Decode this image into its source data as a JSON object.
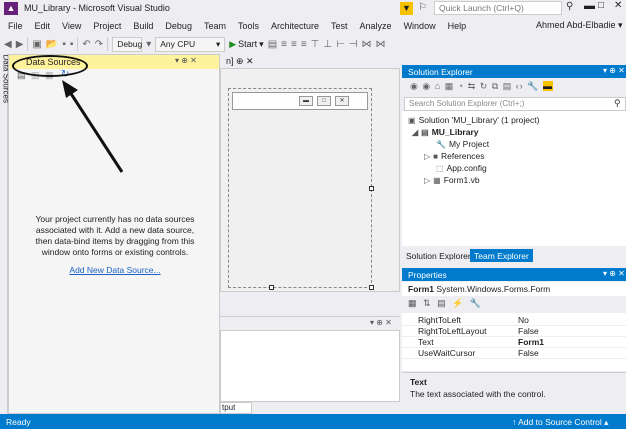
{
  "window": {
    "logo": "▲",
    "title": "MU_Library - Microsoft Visual Studio",
    "quick_launch_placeholder": "Quick Launch (Ctrl+Q)",
    "minimize": "▬",
    "maximize": "□",
    "close": "✕"
  },
  "menu": {
    "items": [
      "File",
      "Edit",
      "View",
      "Project",
      "Build",
      "Debug",
      "Team",
      "Tools",
      "Architecture",
      "Test",
      "Analyze",
      "Window",
      "Help"
    ],
    "user": "Ahmed Abd-Elbadie ▾"
  },
  "toolbar": {
    "config": "Debug",
    "platform": "Any CPU",
    "start": "Start"
  },
  "data_sources": {
    "side_tab_label": "Data Sources",
    "title": "Data Sources",
    "header_controls": "▾ ⊕ ✕",
    "message": "Your project currently has no data sources associated with it. Add a new data source, then data-bind items by dragging from this window onto forms or existing controls.",
    "add_link": "Add New Data Source..."
  },
  "designer": {
    "tab": "n] ⊕ ✕"
  },
  "output": {
    "controls": "▾ ⊕ ✕",
    "tab": "tput"
  },
  "solution_explorer": {
    "title": "Solution Explorer",
    "header_controls": "▾ ⊕ ✕",
    "search_placeholder": "Search Solution Explorer (Ctrl+;)",
    "tree": [
      {
        "label": "Solution 'MU_Library' (1 project)",
        "icon": "▣"
      },
      {
        "label": "MU_Library",
        "icon": "▤",
        "bold": true
      },
      {
        "label": "My Project",
        "icon": "🔑"
      },
      {
        "label": "References",
        "icon": "■"
      },
      {
        "label": "App.config",
        "icon": "⬚"
      },
      {
        "label": "Form1.vb",
        "icon": "▦"
      }
    ],
    "tab_solution": "Solution Explorer",
    "tab_team": "Team Explorer"
  },
  "properties": {
    "title": "Properties",
    "header_controls": "▾ ⊕ ✕",
    "object": "Form1",
    "object_type": "System.Windows.Forms.Form",
    "rows": [
      {
        "name": "RightToLeft",
        "value": "No"
      },
      {
        "name": "RightToLeftLayout",
        "value": "False"
      },
      {
        "name": "Text",
        "value": "Form1",
        "bold": true
      },
      {
        "name": "UseWaitCursor",
        "value": "False"
      }
    ],
    "desc_title": "Text",
    "desc_text": "The text associated with the control."
  },
  "status": {
    "text": "Ready",
    "source_control": "↑  Add to Source Control  ▴"
  }
}
